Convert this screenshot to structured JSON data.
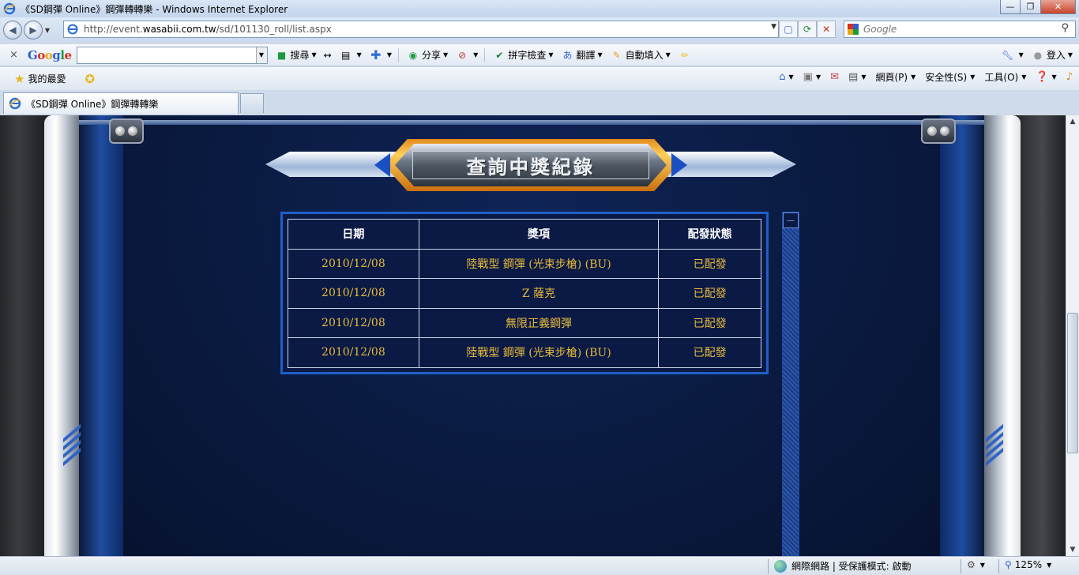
{
  "window": {
    "title": "《SD鋼彈 Online》鋼彈轉轉樂 - Windows Internet Explorer",
    "minimize": "—",
    "maximize": "❐",
    "close": "✕"
  },
  "address": {
    "url_prefix": "http://event.",
    "url_domain": "wasabii.com.tw",
    "url_path": "/sd/101130_roll/list.aspx"
  },
  "search": {
    "placeholder": "Google"
  },
  "google_toolbar": {
    "close": "×",
    "logo_letters": [
      "G",
      "o",
      "o",
      "g",
      "l",
      "e"
    ],
    "search_label": "搜尋",
    "share_label": "分享",
    "spellcheck_label": "拼字檢查",
    "translate_label": "翻譯",
    "autofill_label": "自動填入",
    "signin_label": "登入"
  },
  "favorites": {
    "label": "我的最愛"
  },
  "commands": {
    "page": "網頁(P)",
    "safety": "安全性(S)",
    "tools": "工具(O)"
  },
  "tab": {
    "label": "《SD鋼彈 Online》鋼彈轉轉樂"
  },
  "page": {
    "heading": "查詢中獎紀錄",
    "columns": [
      "日期",
      "獎項",
      "配發狀態"
    ],
    "rows": [
      {
        "date": "2010/12/08",
        "prize": "陸戰型 鋼彈 (光束步槍) (BU)",
        "status": "已配發"
      },
      {
        "date": "2010/12/08",
        "prize": "Z 薩克",
        "status": "已配發"
      },
      {
        "date": "2010/12/08",
        "prize": "無限正義鋼彈",
        "status": "已配發"
      },
      {
        "date": "2010/12/08",
        "prize": "陸戰型 鋼彈 (光束步槍) (BU)",
        "status": "已配發"
      }
    ]
  },
  "statusbar": {
    "zone": "網際網路 | 受保護模式: 啟動",
    "zoom": "125%"
  }
}
